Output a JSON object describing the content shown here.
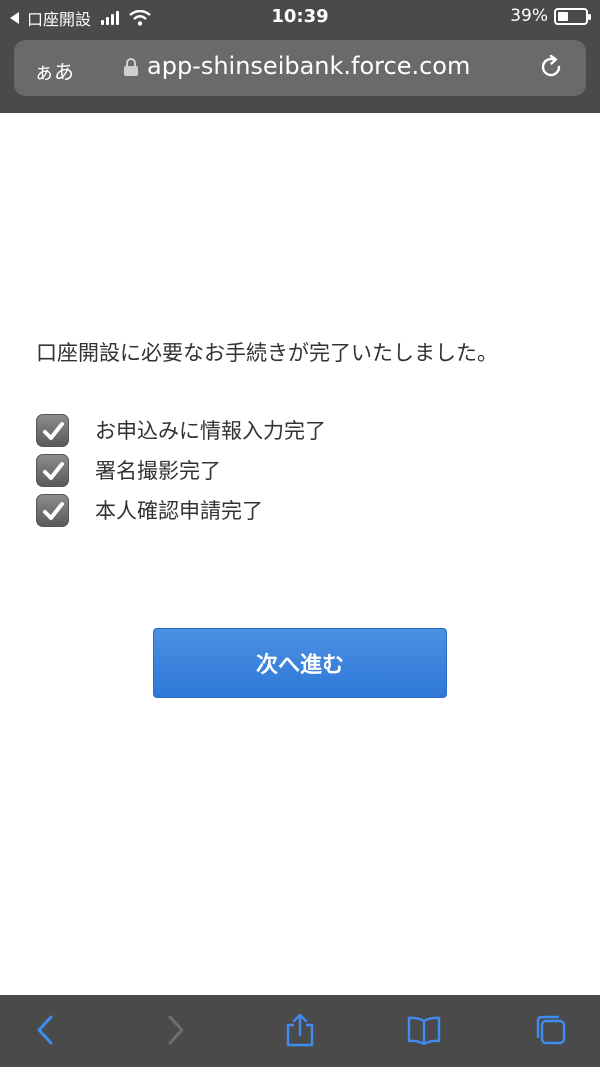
{
  "status_bar": {
    "back_app": "口座開設",
    "time": "10:39",
    "battery_percent": "39%",
    "battery_level": 0.39
  },
  "browser": {
    "text_size_label": "ぁあ",
    "url": "app-shinseibank.force.com"
  },
  "content": {
    "message": "口座開設に必要なお手続きが完了いたしました。",
    "checklist": [
      {
        "label": "お申込みに情報入力完了",
        "checked": true
      },
      {
        "label": "署名撮影完了",
        "checked": true
      },
      {
        "label": "本人確認申請完了",
        "checked": true
      }
    ],
    "next_button_label": "次へ進む"
  },
  "colors": {
    "chrome": "#4a4a4a",
    "accent": "#3a86de",
    "toolbar_icon": "#3f8cf2"
  },
  "toolbar": {
    "icons": [
      "back-icon",
      "forward-icon",
      "share-icon",
      "bookmarks-icon",
      "tabs-icon"
    ]
  }
}
